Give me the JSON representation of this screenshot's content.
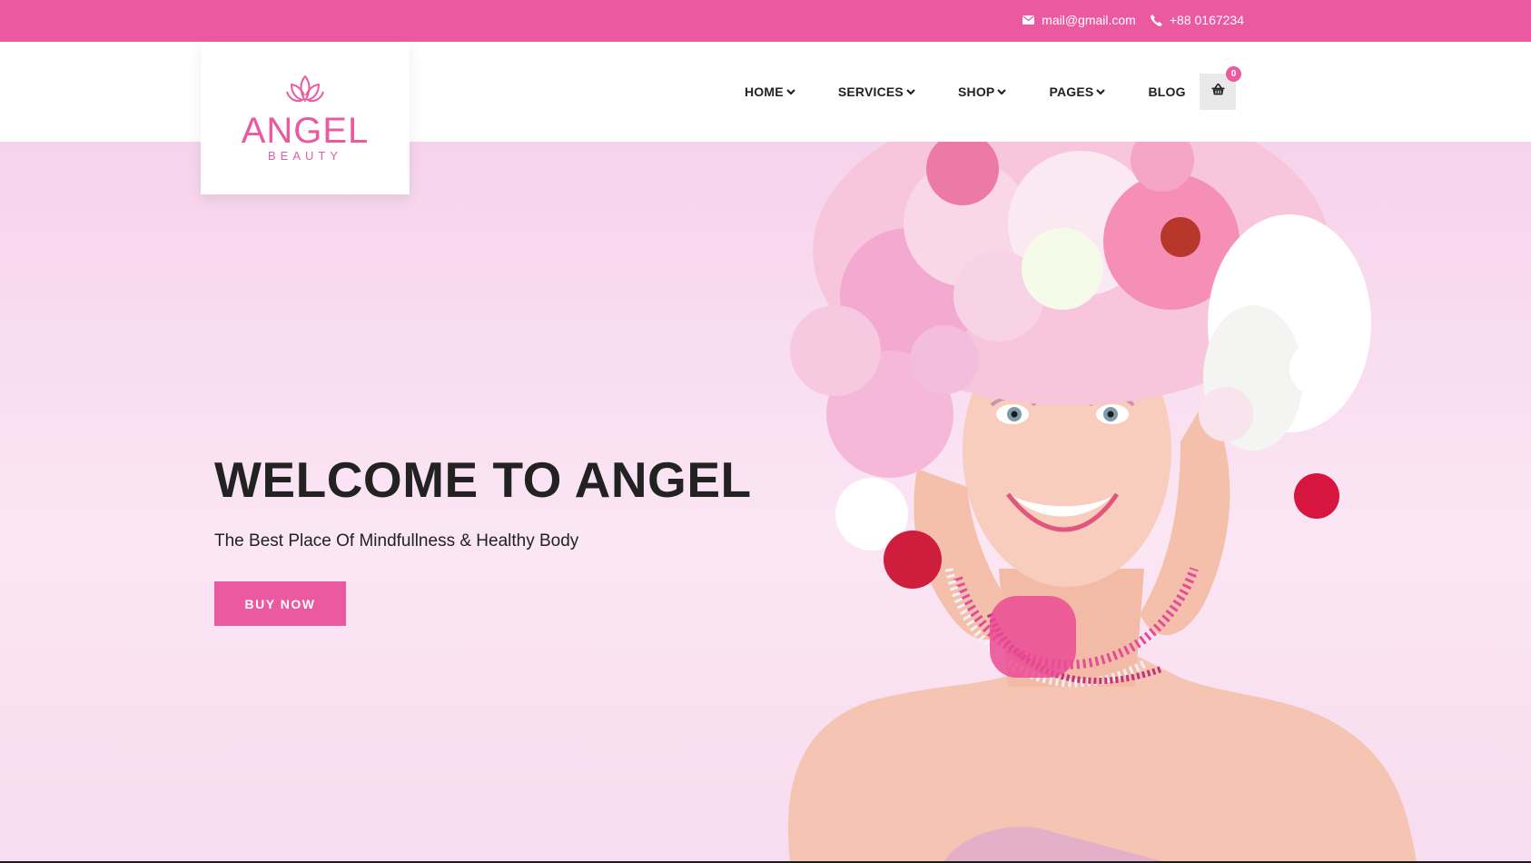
{
  "topbar": {
    "email": "mail@gmail.com",
    "email_icon": "envelope-icon",
    "phone": "+88 0167234",
    "phone_icon": "phone-icon"
  },
  "logo": {
    "name": "ANGEL",
    "sub": "BEAUTY",
    "icon": "lotus-icon"
  },
  "nav": {
    "items": [
      {
        "label": "HOME",
        "has_dropdown": true
      },
      {
        "label": "SERVICES",
        "has_dropdown": true
      },
      {
        "label": "SHOP",
        "has_dropdown": true
      },
      {
        "label": "PAGES",
        "has_dropdown": true
      },
      {
        "label": "BLOG",
        "has_dropdown": false
      }
    ],
    "cart_icon": "shopping-basket-icon",
    "cart_count": "0"
  },
  "hero": {
    "title": "WELCOME TO ANGEL",
    "subtitle": "The Best Place Of Mindfullness & Healthy Body",
    "button_label": "BUY NOW",
    "image": "woman-with-flower-headdress-photo"
  },
  "colors": {
    "accent": "#eb5aa0",
    "hero_bg": "#f9def1",
    "text": "#222222"
  }
}
